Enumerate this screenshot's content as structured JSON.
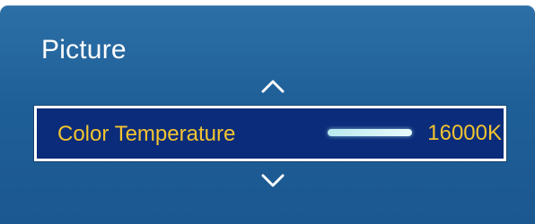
{
  "menu": {
    "title": "Picture",
    "item": {
      "label": "Color Temperature",
      "value": "16000K",
      "slider_fraction": 1.0
    },
    "icons": {
      "up": "chevron-up-icon",
      "down": "chevron-down-icon"
    },
    "colors": {
      "panel": "#1f5f98",
      "selection_bg": "#0b2c7a",
      "selection_border": "#ffffff",
      "accent_text": "#f3c430",
      "slider": "#d8f6f8"
    }
  }
}
